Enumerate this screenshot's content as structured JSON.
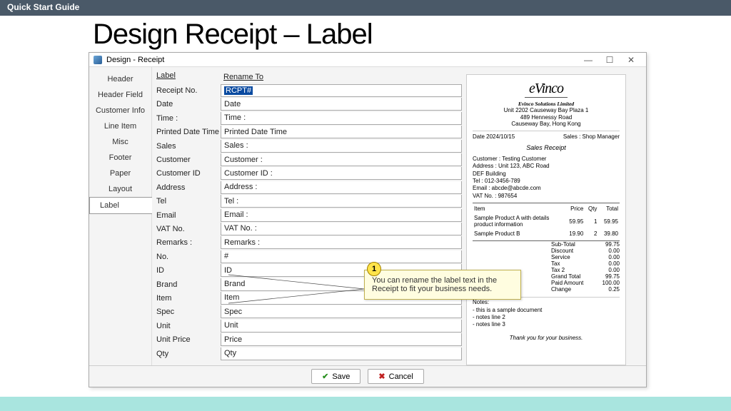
{
  "topbar": "Quick Start Guide",
  "page_title": "Design Receipt – Label",
  "window_title": "Design - Receipt",
  "win_controls": {
    "min": "—",
    "max": "☐",
    "close": "✕"
  },
  "sidebar": {
    "items": [
      "Header",
      "Header Field",
      "Customer Info",
      "Line Item",
      "Misc",
      "Footer",
      "Paper",
      "Layout",
      "Label"
    ],
    "selected_index": 8
  },
  "columns": {
    "col1": "Label",
    "col2": "Rename To"
  },
  "rows": [
    {
      "label": "Receipt No.",
      "value": "RCPT#",
      "selected": true
    },
    {
      "label": "Date",
      "value": "Date"
    },
    {
      "label": "Time :",
      "value": "Time :"
    },
    {
      "label": "Printed Date Time",
      "value": "Printed Date Time"
    },
    {
      "label": "Sales",
      "value": "Sales :"
    },
    {
      "label": "Customer",
      "value": "Customer :"
    },
    {
      "label": "Customer ID",
      "value": "Customer ID :"
    },
    {
      "label": "Address",
      "value": "Address :"
    },
    {
      "label": "Tel",
      "value": "Tel :"
    },
    {
      "label": "Email",
      "value": "Email :"
    },
    {
      "label": "VAT No.",
      "value": "VAT No. :"
    },
    {
      "label": "Remarks :",
      "value": "Remarks :"
    },
    {
      "label": "No.",
      "value": "#"
    },
    {
      "label": "ID",
      "value": "ID"
    },
    {
      "label": "Brand",
      "value": "Brand"
    },
    {
      "label": "Item",
      "value": "Item"
    },
    {
      "label": "Spec",
      "value": "Spec"
    },
    {
      "label": "Unit",
      "value": "Unit"
    },
    {
      "label": "Unit Price",
      "value": "Price"
    },
    {
      "label": "Qty",
      "value": "Qty"
    }
  ],
  "buttons": {
    "save": "Save",
    "cancel": "Cancel"
  },
  "callout": {
    "num": "1",
    "text": "You can rename the label text in the Receipt to fit your business needs."
  },
  "preview": {
    "logo": "eVinco",
    "company": "Evinco Solutions Limited",
    "addr": [
      "Unit 2202 Causeway Bay Plaza 1",
      "489 Hennessy Road",
      "Causeway Bay, Hong Kong"
    ],
    "date_label": "Date 2024/10/15",
    "sales_label": "Sales : Shop Manager",
    "heading": "Sales Receipt",
    "info": [
      "Customer : Testing Customer",
      "Address : Unit 123, ABC Road",
      "DEF Building",
      "Tel : 012-3456-789",
      "Email : abcde@abcde.com",
      "VAT No. : 987654"
    ],
    "table_header": [
      "Item",
      "Price",
      "Qty",
      "Total"
    ],
    "table_rows": [
      {
        "item": "Sample Product A with details product information",
        "price": "59.95",
        "qty": "1",
        "total": "59.95"
      },
      {
        "item": "Sample Product B",
        "price": "19.90",
        "qty": "2",
        "total": "39.80"
      }
    ],
    "totals": [
      [
        "Sub-Total",
        "99.75"
      ],
      [
        "Discount",
        "0.00"
      ],
      [
        "Service",
        "0.00"
      ],
      [
        "Tax",
        "0.00"
      ],
      [
        "Tax 2",
        "0.00"
      ],
      [
        "Grand Total",
        "99.75"
      ],
      [
        "Paid Amount",
        "100.00"
      ],
      [
        "Change",
        "0.25"
      ]
    ],
    "notes_h": "Notes:",
    "notes": [
      "- this is a sample document",
      "- notes line 2",
      "- notes line 3"
    ],
    "thanks": "Thank you for your business."
  }
}
